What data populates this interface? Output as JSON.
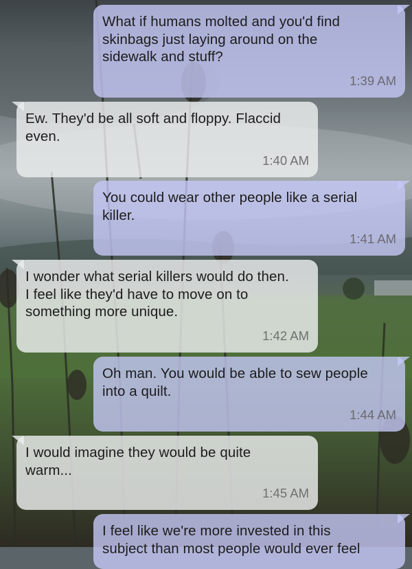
{
  "conversation": {
    "messages": [
      {
        "side": "sent",
        "text": "What if humans molted and you'd find\nskinbags just laying around on the\nsidewalk and stuff?",
        "time": "1:39 AM"
      },
      {
        "side": "received",
        "text": "Ew. They'd be all soft and floppy. Flaccid\neven.",
        "time": "1:40 AM"
      },
      {
        "side": "sent",
        "text": "You could wear other people like a serial\nkiller.",
        "time": "1:41 AM"
      },
      {
        "side": "received",
        "text": "I wonder what serial killers would do then.\nI feel like they'd have to move on to\nsomething more unique.",
        "time": "1:42 AM"
      },
      {
        "side": "sent",
        "text": "Oh man. You would be able to sew people\ninto a quilt.",
        "time": "1:44 AM"
      },
      {
        "side": "received",
        "text": "I would imagine they would be quite\nwarm...",
        "time": "1:45 AM"
      },
      {
        "side": "sent",
        "text": "I feel like we're more invested in this\nsubject than most people would ever feel",
        "time": ""
      }
    ]
  },
  "colors": {
    "sent_bubble": "#c6c8f6",
    "received_bubble": "#eceeee",
    "timestamp": "#6a6a70"
  }
}
